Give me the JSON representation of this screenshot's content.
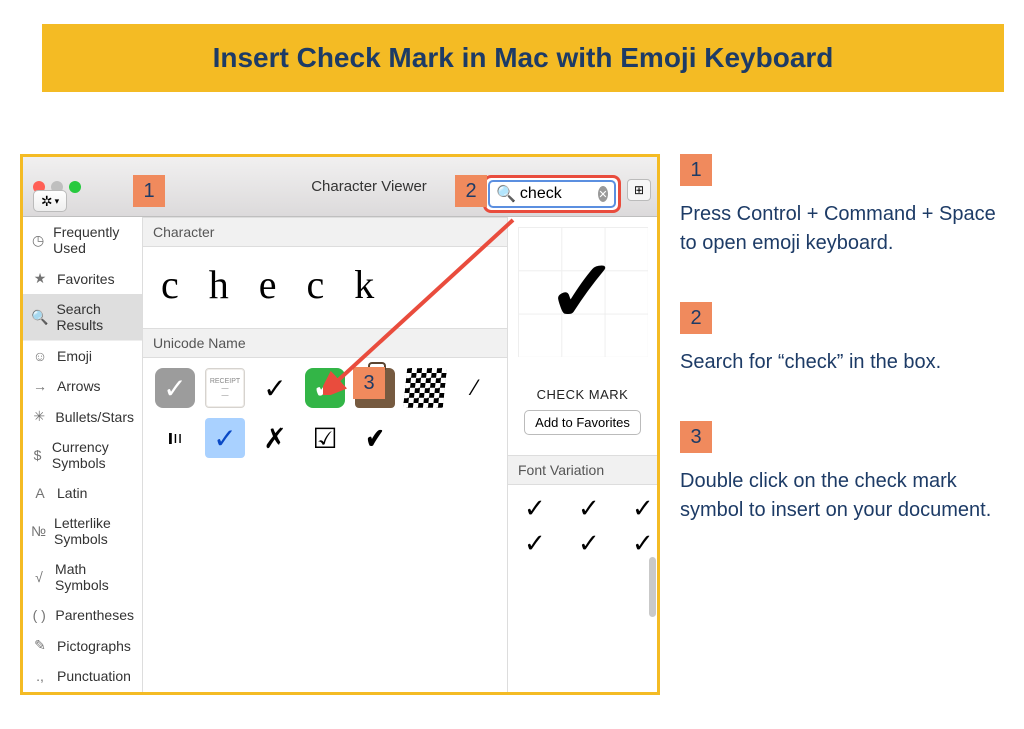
{
  "banner": {
    "title": "Insert Check Mark in Mac with Emoji Keyboard"
  },
  "viewer": {
    "window_title": "Character Viewer",
    "search_value": "check",
    "section_character": "Character",
    "section_unicode": "Unicode Name",
    "chars_display": "check",
    "sidebar": [
      {
        "icon": "◷",
        "label": "Frequently Used",
        "sel": false
      },
      {
        "icon": "★",
        "label": "Favorites",
        "sel": false
      },
      {
        "icon": "🔍",
        "label": "Search Results",
        "sel": true
      },
      {
        "icon": "☺",
        "label": "Emoji",
        "sel": false
      },
      {
        "icon": "→",
        "label": "Arrows",
        "sel": false
      },
      {
        "icon": "✳",
        "label": "Bullets/Stars",
        "sel": false
      },
      {
        "icon": "$",
        "label": "Currency Symbols",
        "sel": false
      },
      {
        "icon": "A",
        "label": "Latin",
        "sel": false
      },
      {
        "icon": "№",
        "label": "Letterlike Symbols",
        "sel": false
      },
      {
        "icon": "√",
        "label": "Math Symbols",
        "sel": false
      },
      {
        "icon": "( )",
        "label": "Parentheses",
        "sel": false
      },
      {
        "icon": "✎",
        "label": "Pictographs",
        "sel": false
      },
      {
        "icon": ".,",
        "label": "Punctuation",
        "sel": false
      }
    ],
    "preview": {
      "glyph": "✓",
      "label": "CHECK MARK",
      "button": "Add to Favorites"
    },
    "font_variation": {
      "title": "Font Variation",
      "glyphs": [
        "✓",
        "✓",
        "✓",
        "✓",
        "✓",
        "✓"
      ]
    }
  },
  "badges": {
    "one": "1",
    "two": "2",
    "three": "3"
  },
  "steps": {
    "s1": "Press Control + Command + Space to open emoji keyboard.",
    "s2": "Search for “check” in the box.",
    "s3": "Double click on the check mark symbol to insert on your document."
  }
}
